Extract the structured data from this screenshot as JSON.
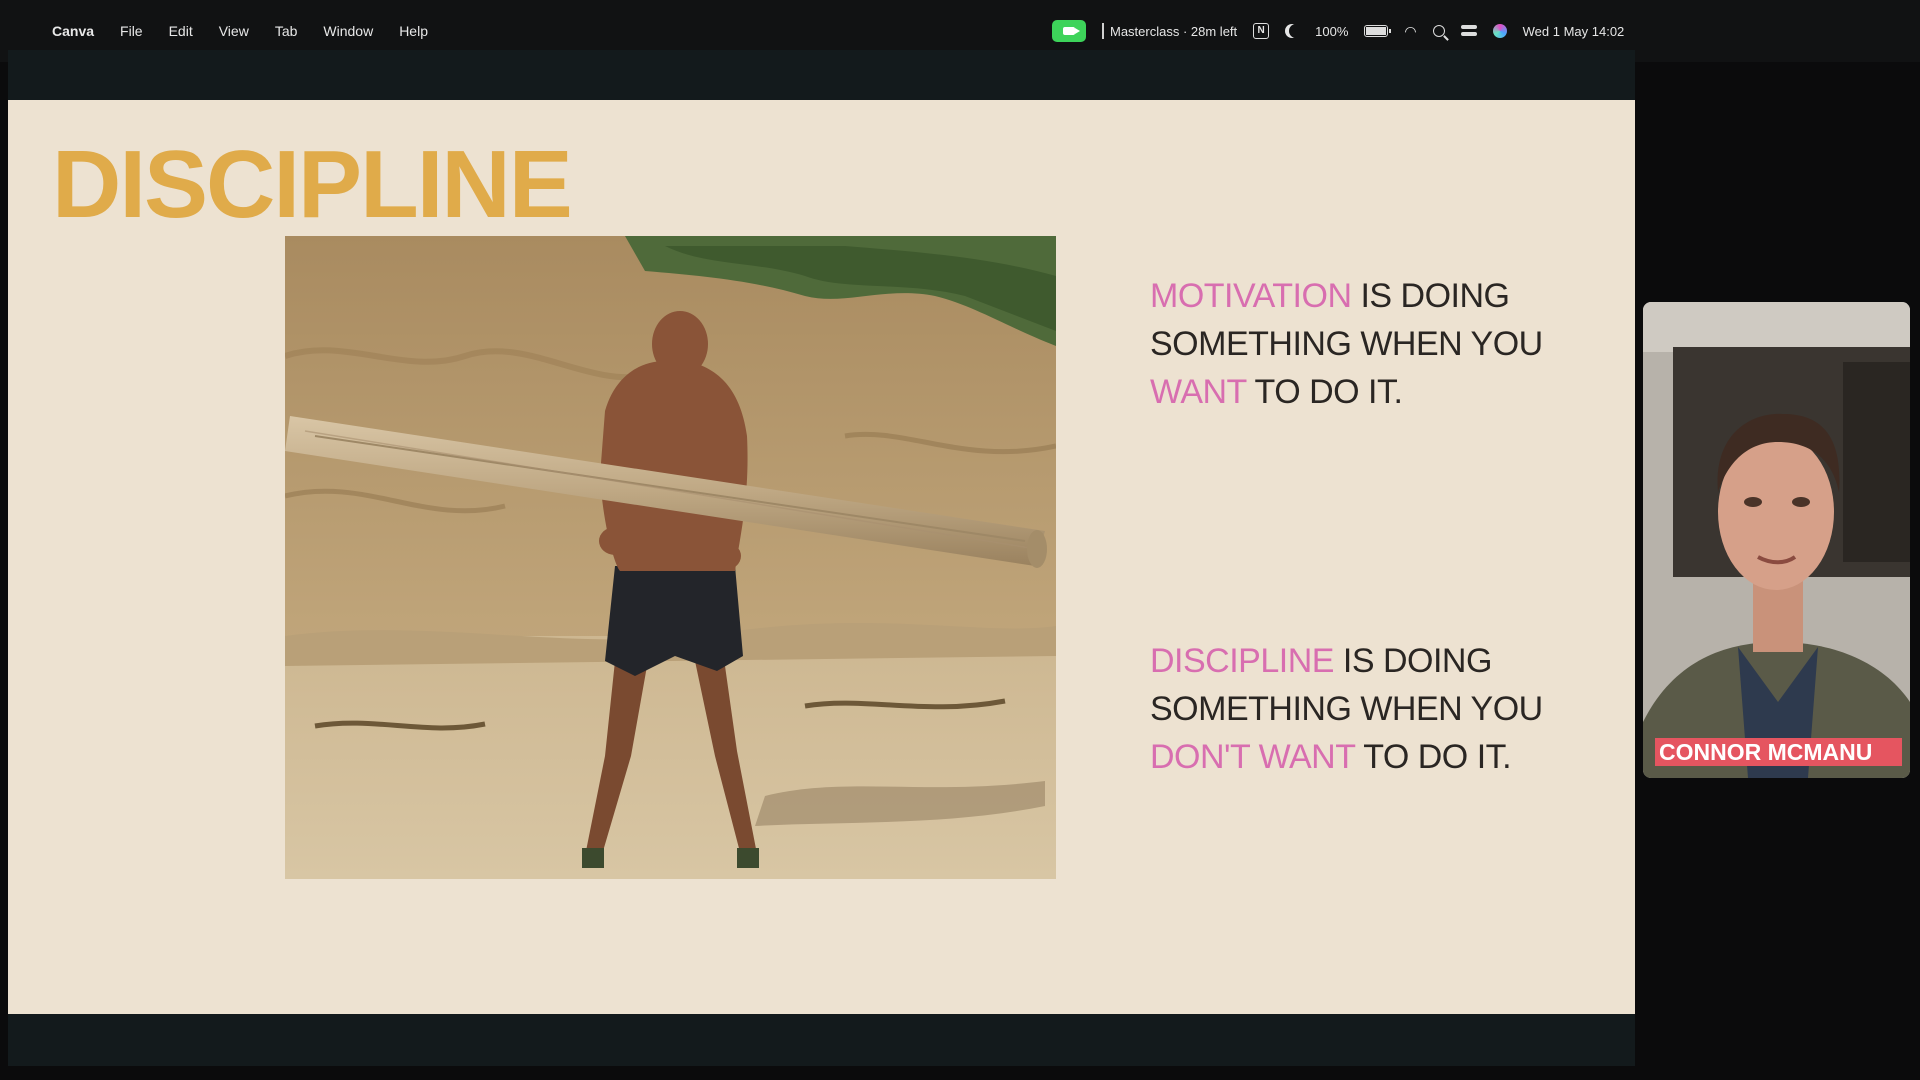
{
  "menubar": {
    "app_name": "Canva",
    "menus": [
      "File",
      "Edit",
      "View",
      "Tab",
      "Window",
      "Help"
    ],
    "status_item": "Masterclass · 28m left",
    "notion_letter": "N",
    "battery_percent": "100%",
    "clock": "Wed 1 May  14:02"
  },
  "slide": {
    "title": "DISCIPLINE",
    "quote1": {
      "highlight": "MOTIVATION",
      "pre": " IS DOING SOMETHING WHEN YOU ",
      "highlight2": "WANT",
      "post": " TO DO IT."
    },
    "quote2": {
      "highlight": "DISCIPLINE",
      "pre": " IS DOING SOMETHING WHEN YOU ",
      "highlight2": "DON'T WANT",
      "post": " TO DO IT."
    }
  },
  "webcam": {
    "name_tag": "CONNOR MCMANU"
  },
  "colors": {
    "title": "#e0ab4a",
    "highlight": "#d86eb0",
    "slide_bg": "#ede2d1",
    "name_tag_bg": "#e55560",
    "rec_green": "#3dd35a"
  }
}
